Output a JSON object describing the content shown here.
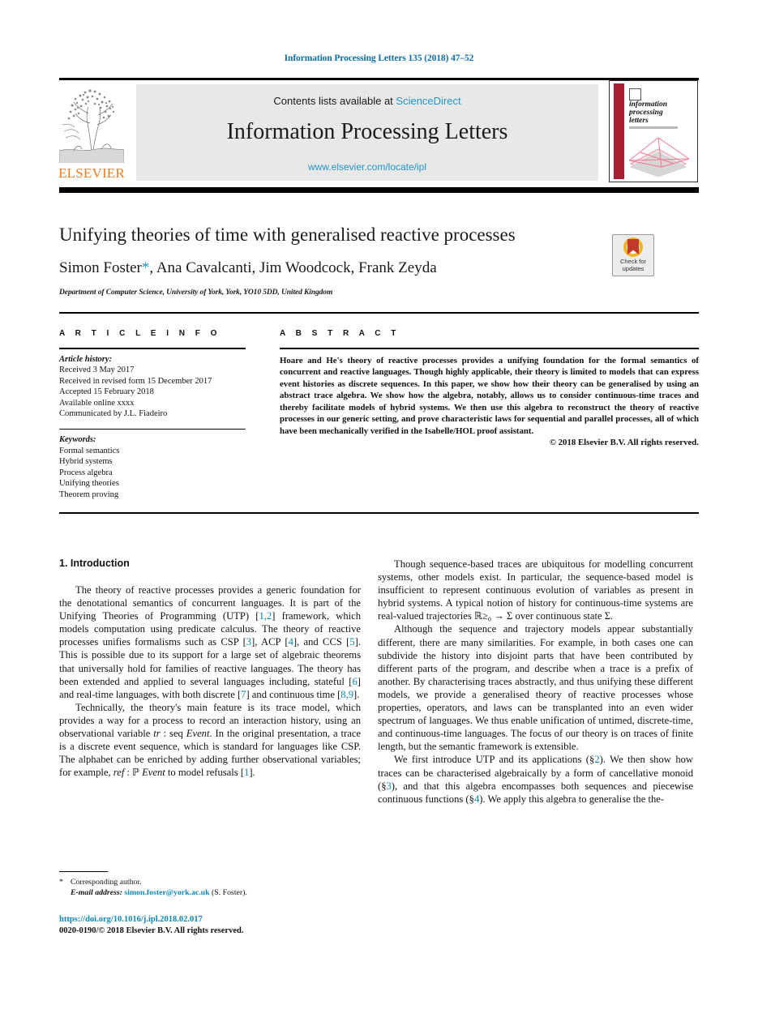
{
  "running_head": "Information Processing Letters 135 (2018) 47–52",
  "masthead": {
    "publisher_name": "ELSEVIER",
    "contents_prefix": "Contents lists available at ",
    "contents_link": "ScienceDirect",
    "journal_title": "Information Processing Letters",
    "journal_url": "www.elsevier.com/locate/ipl",
    "cover": {
      "line1": "information",
      "line2": "processing",
      "line3": "letters"
    },
    "colors": {
      "band": "#e8e8e8",
      "link": "#2196c9",
      "elsevier_orange": "#f07d1a",
      "cover_red": "#a81f32"
    }
  },
  "article": {
    "title": "Unifying theories of time with generalised reactive processes",
    "authors": "Simon Foster",
    "corresponding_marker": "*",
    "authors_rest": ", Ana Cavalcanti, Jim Woodcock, Frank Zeyda",
    "affiliation": "Department of Computer Science, University of York, York, YO10 5DD, United Kingdom",
    "crossmark_label_line1": "Check for",
    "crossmark_label_line2": "updates"
  },
  "info": {
    "heading": "A R T I C L E  I N F O",
    "history_label": "Article history:",
    "history": [
      "Received 3 May 2017",
      "Received in revised form 15 December 2017",
      "Accepted 15 February 2018",
      "Available online xxxx",
      "Communicated by J.L. Fiadeiro"
    ],
    "keywords_label": "Keywords:",
    "keywords": [
      "Formal semantics",
      "Hybrid systems",
      "Process algebra",
      "Unifying theories",
      "Theorem proving"
    ]
  },
  "abstract": {
    "heading": "A B S T R A C T",
    "text": "Hoare and He's theory of reactive processes provides a unifying foundation for the formal semantics of concurrent and reactive languages. Though highly applicable, their theory is limited to models that can express event histories as discrete sequences. In this paper, we show how their theory can be generalised by using an abstract trace algebra. We show how the algebra, notably, allows us to consider continuous-time traces and thereby facilitate models of hybrid systems. We then use this algebra to reconstruct the theory of reactive processes in our generic setting, and prove characteristic laws for sequential and parallel processes, all of which have been mechanically verified in the Isabelle/HOL proof assistant.",
    "copyright": "© 2018 Elsevier B.V. All rights reserved."
  },
  "body": {
    "section_heading": "1. Introduction",
    "left_paragraphs": [
      {
        "id": "p1",
        "parts": [
          {
            "t": "The theory of reactive processes provides a generic foundation for the denotational semantics of concurrent languages. It is part of the Unifying Theories of Programming (UTP) ["
          },
          {
            "t": "1,2",
            "cite": true
          },
          {
            "t": "] framework, which models computation using predicate calculus. The theory of reactive processes unifies formalisms such as CSP ["
          },
          {
            "t": "3",
            "cite": true
          },
          {
            "t": "], ACP ["
          },
          {
            "t": "4",
            "cite": true
          },
          {
            "t": "], and CCS ["
          },
          {
            "t": "5",
            "cite": true
          },
          {
            "t": "]. This is possible due to its support for a large set of algebraic theorems that universally hold for families of reactive languages. The theory has been extended and applied to several languages including, stateful ["
          },
          {
            "t": "6",
            "cite": true
          },
          {
            "t": "] and real-time languages, with both discrete ["
          },
          {
            "t": "7",
            "cite": true
          },
          {
            "t": "] and continuous time ["
          },
          {
            "t": "8,9",
            "cite": true
          },
          {
            "t": "]."
          }
        ]
      },
      {
        "id": "p2",
        "parts": [
          {
            "t": "Technically, the theory's main feature is its trace model, which provides a way for a process to record an interaction history, using an observational variable "
          },
          {
            "t": "tr",
            "italic": true
          },
          {
            "t": " : seq "
          },
          {
            "t": "Event",
            "italic": true
          },
          {
            "t": ". In the original presentation, a trace is a discrete event sequence, which is standard for languages like CSP. The alphabet can be enriched by adding further observational variables; for example, "
          },
          {
            "t": "ref",
            "italic": true
          },
          {
            "t": " : ℙ "
          },
          {
            "t": "Event",
            "italic": true
          },
          {
            "t": " to model refusals ["
          },
          {
            "t": "1",
            "cite": true
          },
          {
            "t": "]."
          }
        ]
      }
    ],
    "right_paragraphs": [
      {
        "id": "p3",
        "parts": [
          {
            "t": "Though sequence-based traces are ubiquitous for modelling concurrent systems, other models exist. In particular, the sequence-based model is insufficient to represent continuous evolution of variables as present in hybrid systems. A typical notion of history for continuous-time systems are real-valued trajectories ℝ≥₀ → Σ over continuous state Σ."
          }
        ]
      },
      {
        "id": "p4",
        "parts": [
          {
            "t": "Although the sequence and trajectory models appear substantially different, there are many similarities. For example, in both cases one can subdivide the history into disjoint parts that have been contributed by different parts of the program, and describe when a trace is a prefix of another. By characterising traces abstractly, and thus unifying these different models, we provide a generalised theory of reactive processes whose properties, operators, and laws can be transplanted into an even wider spectrum of languages. We thus enable unification of untimed, discrete-time, and continuous-time languages. The focus of our theory is on traces of finite length, but the semantic framework is extensible."
          }
        ]
      },
      {
        "id": "p5",
        "parts": [
          {
            "t": "We first introduce UTP and its applications (§"
          },
          {
            "t": "2",
            "cite": true
          },
          {
            "t": "). We then show how traces can be characterised algebraically by a form of cancellative monoid (§"
          },
          {
            "t": "3",
            "cite": true
          },
          {
            "t": "), and that this algebra encompasses both sequences and piecewise continuous functions (§"
          },
          {
            "t": "4",
            "cite": true
          },
          {
            "t": "). We apply this algebra to generalise the the-"
          }
        ]
      }
    ]
  },
  "footnote": {
    "star": "*",
    "corresponding": "Corresponding author.",
    "email_label": "E-mail address:",
    "email": "simon.foster@york.ac.uk",
    "email_suffix": "(S. Foster)."
  },
  "footer": {
    "doi": "https://doi.org/10.1016/j.ipl.2018.02.017",
    "issn_copyright": "0020-0190/© 2018 Elsevier B.V. All rights reserved."
  }
}
